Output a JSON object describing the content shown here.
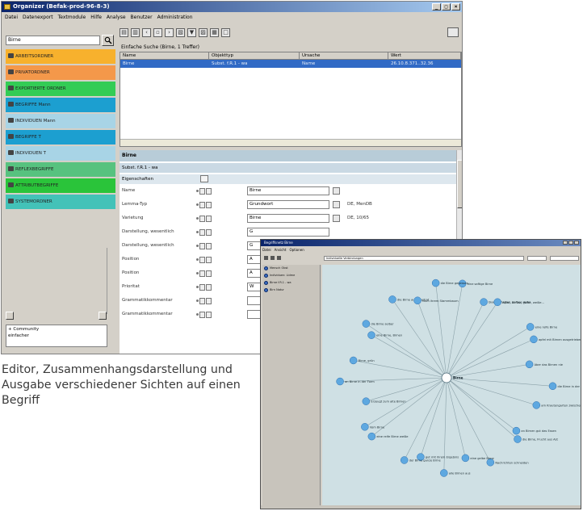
{
  "window1": {
    "title": "Organizer (Befak-prod-96-8-3)",
    "menu": [
      "Datei",
      "Datenexport",
      "Textmodule",
      "Hilfe",
      "Analyse",
      "Benutzer",
      "Administration"
    ],
    "window_buttons": [
      "_",
      "□",
      "×"
    ],
    "search_value": "Birne",
    "folders": [
      {
        "label": "ARBEITSORDNER",
        "color": "#f7b12d"
      },
      {
        "label": "PRIVATORDNER",
        "color": "#f4984a"
      },
      {
        "label": "EXPORTIERTE ORDNER",
        "color": "#33cc55"
      },
      {
        "label": "BEGRIFFE Mann",
        "color": "#1c9fd0"
      },
      {
        "label": "INDIVIDUEN Mann",
        "color": "#a8d4e6"
      },
      {
        "label": "BEGRIFFE T",
        "color": "#1c9fd0"
      },
      {
        "label": "INDIVIDUEN T",
        "color": "#a8d4e6"
      },
      {
        "label": "REFLEXBEGRIFFE",
        "color": "#57c27f"
      },
      {
        "label": "ATTRIBUTBEGRIFFE",
        "color": "#2ac43a"
      },
      {
        "label": "SYSTEMORDNER",
        "color": "#43c2b8"
      }
    ],
    "left_text": [
      "+ Community",
      "einfacher"
    ],
    "search_result_label": "Einfache Suche (Birne, 1 Treffer)",
    "table": {
      "columns": [
        "Name",
        "Objekttyp",
        "Ursache",
        "Wert"
      ],
      "rows": [
        [
          "Birne",
          "Subst. f.R.1 - wa",
          "Name",
          "26.10.8.371..32.36"
        ]
      ]
    },
    "details": {
      "title": "Birne",
      "subtitle": "Subst. f.R.1 - wa",
      "properties_header": "Eigenschaften",
      "properties": [
        {
          "label": "Name",
          "value": "Birne",
          "extra": ""
        },
        {
          "label": "Lemma-Typ",
          "value": "Grundwort",
          "extra": "DE, MenDB"
        },
        {
          "label": "Varietung",
          "value": "Birne",
          "extra": "DE, 10/65"
        },
        {
          "label": "Darstellung, wesentlich",
          "value": "G",
          "extra": ""
        },
        {
          "label": "Darstellung, wesentlich",
          "value": "G",
          "extra": ""
        },
        {
          "label": "Position",
          "value": "A",
          "extra": ""
        },
        {
          "label": "Position",
          "value": "A",
          "extra": ""
        },
        {
          "label": "Prioritat",
          "value": "W",
          "extra": ""
        },
        {
          "label": "Grammatikkommentar",
          "value": "",
          "extra": ""
        },
        {
          "label": "Grammatikkommentar",
          "value": "",
          "extra": ""
        }
      ]
    }
  },
  "caption": "Editor, Zusammenhangsdarstellung und Ausgabe verschiedener Sichten auf einen Begriff",
  "window2": {
    "title": "Begriffsnetz Birne",
    "menu": [
      "Datei",
      "Ansicht",
      "Optionen"
    ],
    "filter_text": "Individuelle Verbindungen",
    "sidebar_items": [
      "Mensch Obst",
      "Individuen: Lidme",
      "Birne f.R.1 - wa",
      "Birn Natur"
    ],
    "center_label": "Birne",
    "nodes": [
      "eine saftige Birne",
      "blaue Schatten, saftige Apfel",
      "Apfel, Birnen, gelbe, weiße...",
      "eine reife Birne",
      "apfel mit Birnen ausgetrieben",
      "Aber das Birnen nie",
      "die Birne in der Zeit",
      "am Krautengarten zwischen",
      "an Birnen gut das Essen",
      "die Birne, Frucht aus Ast",
      "Nachrichten schneiden",
      "eine gelbe Birne",
      "alle Birnen aus",
      "gut mit ihrem Ergebnis",
      "der Birne ganze Birne",
      "eine reife Birne weiße",
      "Vom Birne",
      "Erzeugt zum alte Birnen",
      "an Birne in der Form",
      "Birne, grün",
      "eine Birne, Birnen",
      "die Birne selber",
      "die Birne aus Quadrat",
      "nach ihrem Stammbaum",
      "die Birne gegessen"
    ]
  }
}
